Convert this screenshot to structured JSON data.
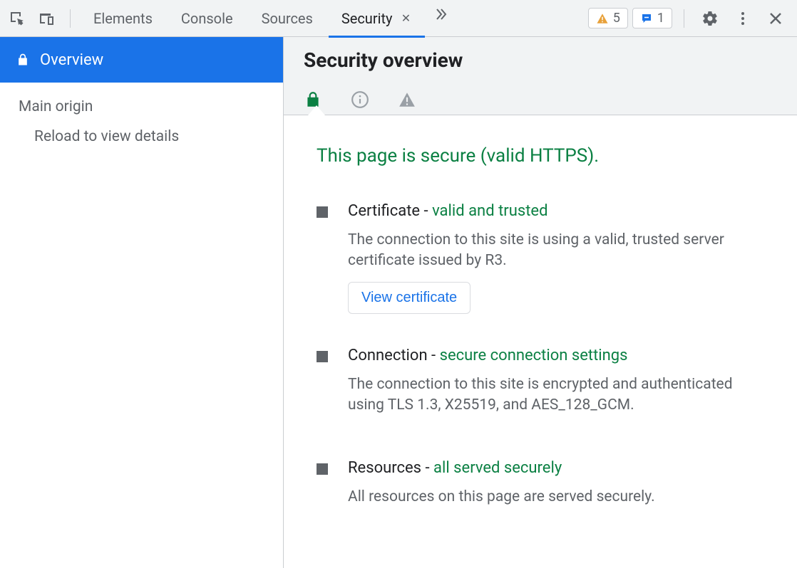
{
  "toolbar": {
    "tabs": {
      "elements": "Elements",
      "console": "Console",
      "sources": "Sources",
      "security": "Security"
    },
    "warning_count": "5",
    "info_count": "1"
  },
  "sidebar": {
    "overview": "Overview",
    "main_origin": "Main origin",
    "reload_hint": "Reload to view details"
  },
  "main": {
    "title": "Security overview",
    "headline": "This page is secure (valid HTTPS).",
    "cert": {
      "title_pre": "Certificate - ",
      "title_status": "valid and trusted",
      "desc": "The connection to this site is using a valid, trusted server certificate issued by R3.",
      "button": "View certificate"
    },
    "conn": {
      "title_pre": "Connection - ",
      "title_status": "secure connection settings",
      "desc": "The connection to this site is encrypted and authenticated using TLS 1.3, X25519, and AES_128_GCM."
    },
    "res": {
      "title_pre": "Resources - ",
      "title_status": "all served securely",
      "desc": "All resources on this page are served securely."
    }
  }
}
